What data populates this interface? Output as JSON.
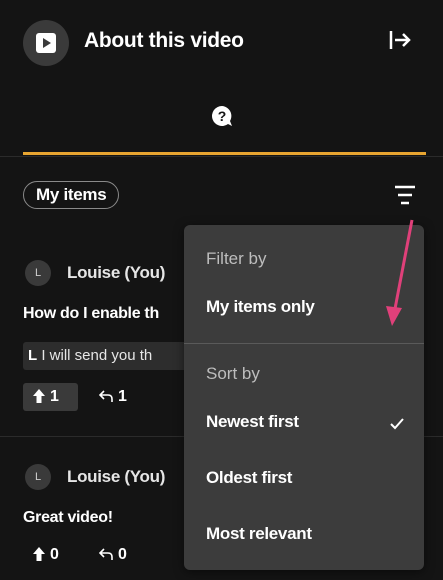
{
  "header": {
    "title": "About this video"
  },
  "filter_chip": {
    "label": "My items"
  },
  "comments": [
    {
      "avatar_initial": "L",
      "author": "Louise (You)",
      "text": "How do I enable th",
      "reply": {
        "initial": "L",
        "text": "I will send you th"
      },
      "upvotes": "1",
      "replies": "1"
    },
    {
      "avatar_initial": "L",
      "author": "Louise (You)",
      "text": "Great video!",
      "upvotes": "0",
      "replies": "0"
    }
  ],
  "menu": {
    "filter_header": "Filter by",
    "filter_option": "My items only",
    "sort_header": "Sort by",
    "sort_options": [
      "Newest first",
      "Oldest first",
      "Most relevant"
    ],
    "selected_sort": "Newest first"
  },
  "colors": {
    "background": "#141414",
    "accent_underline": "#e8a531",
    "menu_background": "#3c3c3c",
    "annotation_arrow": "#e0407a"
  },
  "icons": [
    "play-icon",
    "exit-panel-icon",
    "question-bubble-icon",
    "filter-icon",
    "upvote-icon",
    "reply-icon",
    "checkmark-icon"
  ]
}
